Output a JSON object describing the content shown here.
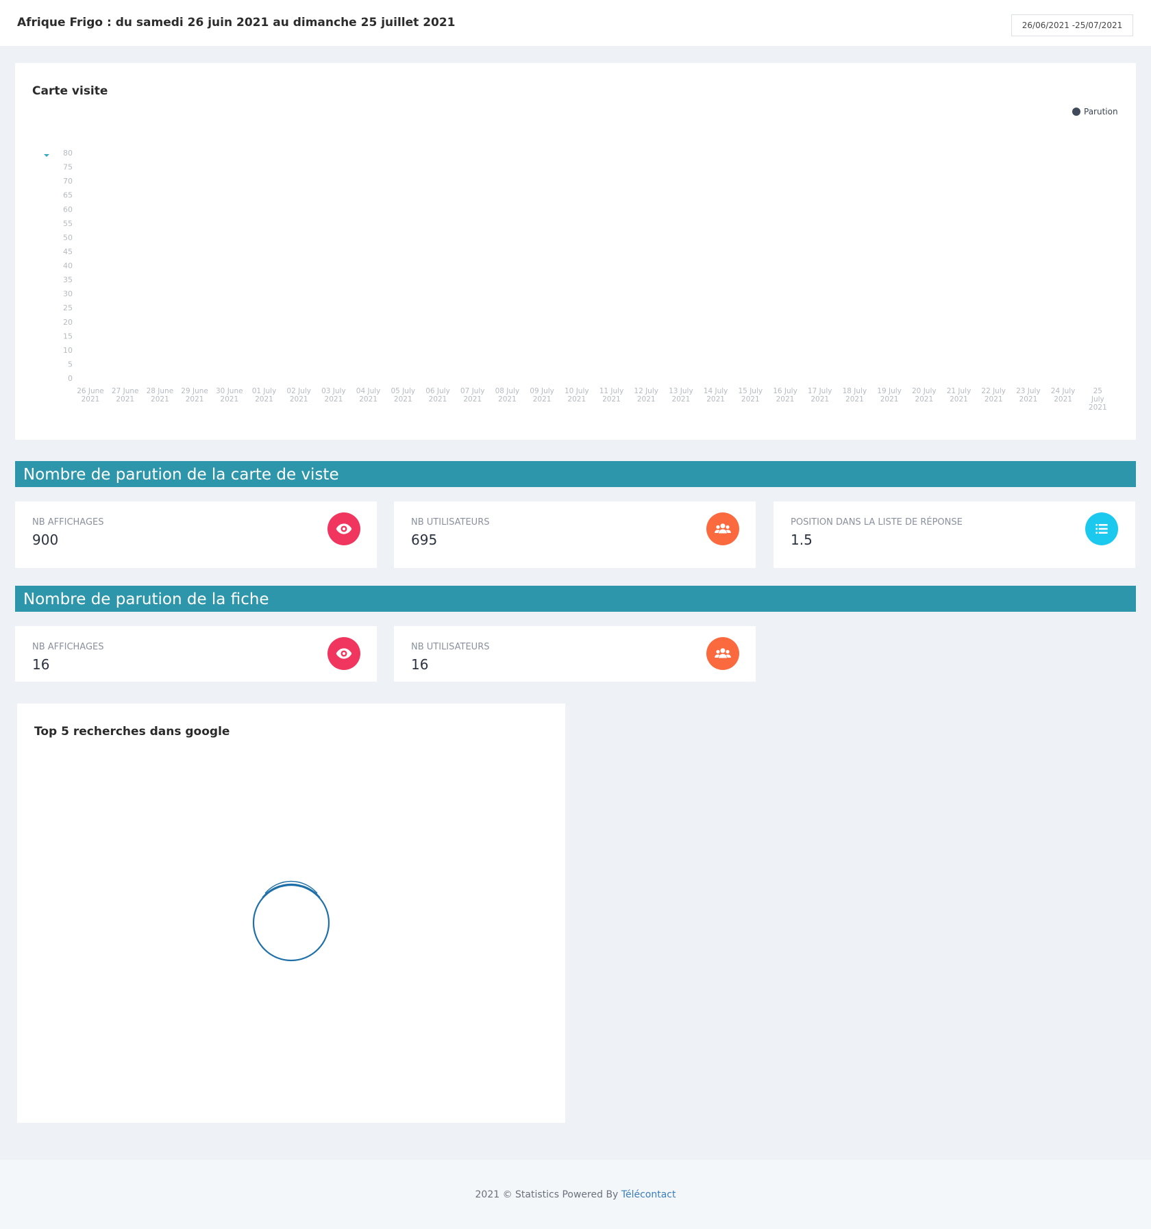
{
  "header": {
    "title": "Afrique Frigo : du samedi 26 juin 2021 au dimanche 25 juillet 2021",
    "date_range": "26/06/2021 -25/07/2021"
  },
  "chart_card": {
    "title": "Carte visite",
    "legend_label": "Parution",
    "legend_color": "#3f4a5a",
    "marker_color": "#3aa6c0"
  },
  "chart_data": {
    "type": "bar",
    "title": "Carte visite",
    "xlabel": "",
    "ylabel": "",
    "ylim": [
      0,
      80
    ],
    "y_ticks": [
      0,
      5,
      10,
      15,
      20,
      25,
      30,
      35,
      40,
      45,
      50,
      55,
      60,
      65,
      70,
      75,
      80
    ],
    "categories": [
      [
        "26 June",
        "2021"
      ],
      [
        "27 June",
        "2021"
      ],
      [
        "28 June",
        "2021"
      ],
      [
        "29 June",
        "2021"
      ],
      [
        "30 June",
        "2021"
      ],
      [
        "01 July",
        "2021"
      ],
      [
        "02 July",
        "2021"
      ],
      [
        "03 July",
        "2021"
      ],
      [
        "04 July",
        "2021"
      ],
      [
        "05 July",
        "2021"
      ],
      [
        "06 July",
        "2021"
      ],
      [
        "07 July",
        "2021"
      ],
      [
        "08 July",
        "2021"
      ],
      [
        "09 July",
        "2021"
      ],
      [
        "10 July",
        "2021"
      ],
      [
        "11 July",
        "2021"
      ],
      [
        "12 July",
        "2021"
      ],
      [
        "13 July",
        "2021"
      ],
      [
        "14 July",
        "2021"
      ],
      [
        "15 July",
        "2021"
      ],
      [
        "16 July",
        "2021"
      ],
      [
        "17 July",
        "2021"
      ],
      [
        "18 July",
        "2021"
      ],
      [
        "19 July",
        "2021"
      ],
      [
        "20 July",
        "2021"
      ],
      [
        "21 July",
        "2021"
      ],
      [
        "22 July",
        "2021"
      ],
      [
        "23 July",
        "2021"
      ],
      [
        "24 July",
        "2021"
      ],
      [
        "25",
        "July",
        "2021"
      ]
    ],
    "series": [
      {
        "name": "Parution",
        "values": []
      }
    ],
    "legend": "top-right",
    "grid": false
  },
  "section_carte": {
    "title": "Nombre de parution de la carte de viste",
    "stats": [
      {
        "label": "NB AFFICHAGES",
        "value": "900",
        "icon": "eye-icon",
        "color": "#f0365f"
      },
      {
        "label": "NB UTILISATEURS",
        "value": "695",
        "icon": "users-icon",
        "color": "#fb6a3e"
      },
      {
        "label": "POSITION DANS LA LISTE DE RÉPONSE",
        "value": "1.5",
        "icon": "list-icon",
        "color": "#1bc8ee"
      }
    ]
  },
  "section_fiche": {
    "title": "Nombre de parution de la fiche",
    "stats": [
      {
        "label": "NB AFFICHAGES",
        "value": "16",
        "icon": "eye-icon",
        "color": "#f0365f"
      },
      {
        "label": "NB UTILISATEURS",
        "value": "16",
        "icon": "users-icon",
        "color": "#fb6a3e"
      }
    ]
  },
  "google_card": {
    "title": "Top 5 recherches dans google",
    "spinner_color": "#1f6fa8"
  },
  "footer": {
    "prefix": "2021 © Statistics Powered By ",
    "link": "Télécontact"
  },
  "colors": {
    "section_header": "#2e96aa",
    "background": "#eef1f5",
    "axis_text": "#b5bac2"
  }
}
